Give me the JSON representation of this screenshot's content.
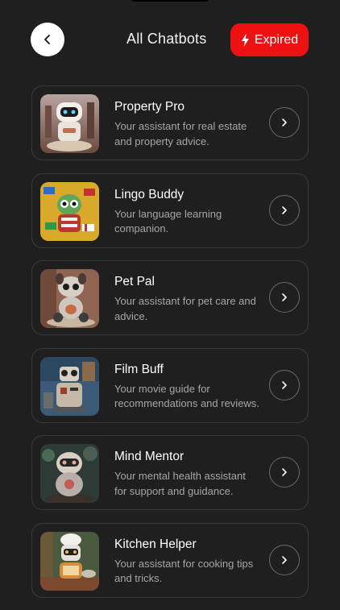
{
  "header": {
    "title": "All Chatbots",
    "expired_label": "Expired",
    "accent_color": "#ee1111"
  },
  "icons": {
    "back": "chevron-left-icon",
    "expired": "lightning-icon",
    "go": "chevron-right-icon"
  },
  "chatbots": [
    {
      "name": "Property Pro",
      "description": "Your assistant for real estate and property advice."
    },
    {
      "name": "Lingo Buddy",
      "description": "Your language learning companion."
    },
    {
      "name": "Pet Pal",
      "description": "Your assistant for pet care and advice."
    },
    {
      "name": "Film Buff",
      "description": "Your movie guide for recommendations and reviews."
    },
    {
      "name": "Mind Mentor",
      "description": "Your mental health assistant for support and guidance."
    },
    {
      "name": "Kitchen Helper",
      "description": "Your assistant for cooking tips and tricks."
    }
  ]
}
